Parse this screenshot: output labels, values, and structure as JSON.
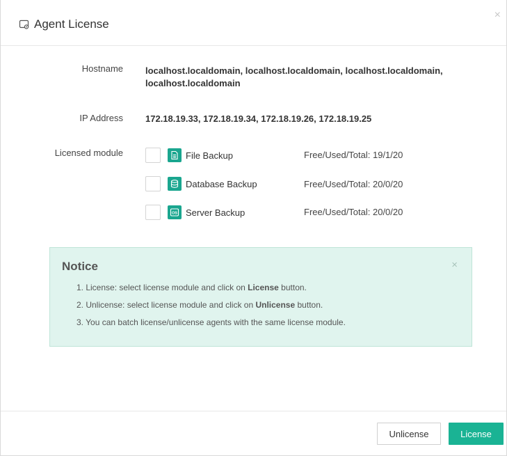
{
  "dialog": {
    "title": "Agent License",
    "title_icon": "license-icon",
    "close_icon": "close-icon",
    "close_glyph": "×"
  },
  "hostname": {
    "label": "Hostname",
    "value": "localhost.localdomain, localhost.localdomain, localhost.localdomain, localhost.localdomain"
  },
  "ip": {
    "label": "IP Address",
    "value": "172.18.19.33, 172.18.19.34, 172.18.19.26, 172.18.19.25"
  },
  "modules": {
    "label": "Licensed module",
    "items": [
      {
        "name": "File Backup",
        "stats": "Free/Used/Total: 19/1/20",
        "icon": "file-icon",
        "checked": false
      },
      {
        "name": "Database Backup",
        "stats": "Free/Used/Total: 20/0/20",
        "icon": "database-icon",
        "checked": false
      },
      {
        "name": "Server Backup",
        "stats": "Free/Used/Total: 20/0/20",
        "icon": "os-icon",
        "checked": false
      }
    ]
  },
  "notice": {
    "title": "Notice",
    "close_glyph": "×",
    "items": [
      {
        "prefix": "1. License: select license module and click on ",
        "bold": "License",
        "suffix": " button."
      },
      {
        "prefix": "2. Unlicense: select license module and click on ",
        "bold": "Unlicense",
        "suffix": " button."
      },
      {
        "prefix": "3. You can batch license/unlicense agents with the same license module.",
        "bold": "",
        "suffix": ""
      }
    ]
  },
  "footer": {
    "unlicense_label": "Unlicense",
    "license_label": "License"
  },
  "colors": {
    "accent": "#1ab394",
    "notice_bg": "#e0f4ee",
    "notice_border": "#bfe5d8"
  }
}
